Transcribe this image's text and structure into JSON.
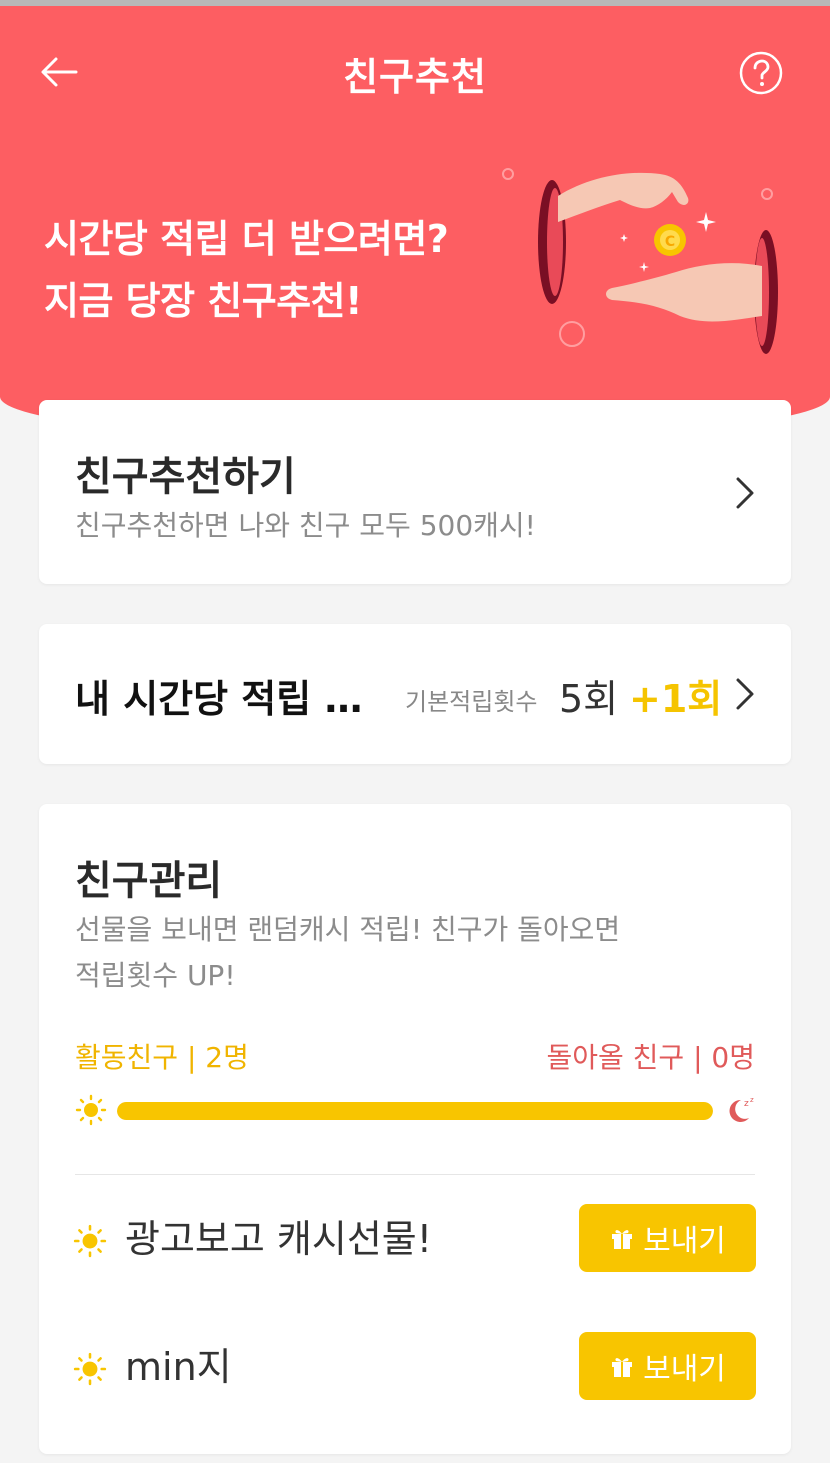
{
  "header": {
    "title": "친구추천",
    "banner_line1": "시간당 적립 더 받으려면?",
    "banner_line2": "지금 당장 친구추천!"
  },
  "icons": {
    "back": "arrow-left-icon",
    "help": "question-circle-icon",
    "chevron": "chevron-right-icon",
    "sun": "sun-icon",
    "moon": "sleeping-moon-icon",
    "gift": "gift-icon"
  },
  "colors": {
    "brand": "#fd5e62",
    "accent": "#f8c500",
    "inactive_text": "#e05a5a"
  },
  "recommend_card": {
    "title": "친구추천하기",
    "subtitle": "친구추천하면 나와 친구 모두 500캐시!"
  },
  "hourly_card": {
    "title": "내 시간당 적립 …",
    "base_label": "기본적립횟수",
    "base_value": "5회",
    "bonus_value": "+1회"
  },
  "friends_card": {
    "title": "친구관리",
    "subtitle_line1": "선물을 보내면 랜덤캐시 적립! 친구가 돌아오면",
    "subtitle_line2": "적립횟수 UP!",
    "active_label": "활동친구 | 2명",
    "inactive_label": "돌아올 친구 | 0명",
    "active_count": 2,
    "inactive_count": 0,
    "friends": [
      {
        "name": "광고보고 캐시선물!",
        "button": "보내기"
      },
      {
        "name": "min지",
        "button": "보내기"
      }
    ]
  }
}
